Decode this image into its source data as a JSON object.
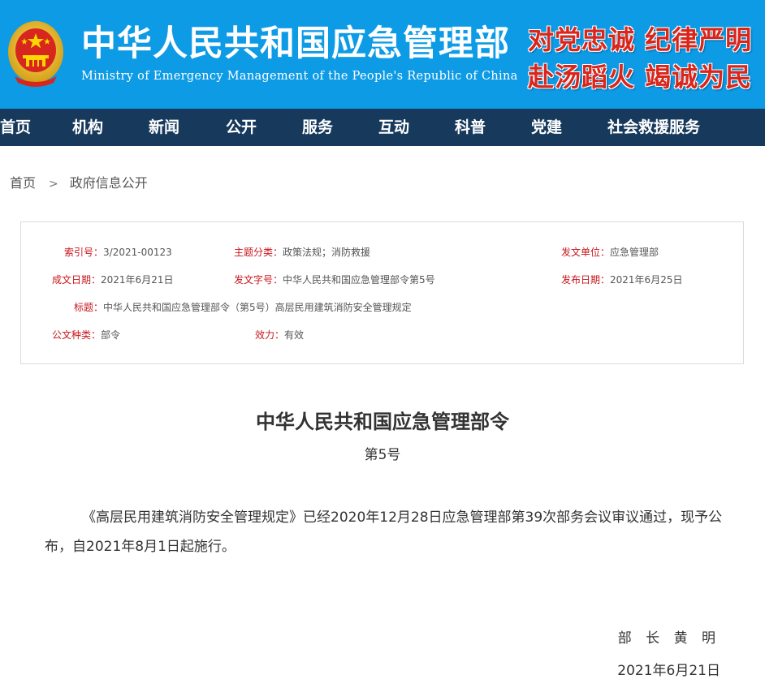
{
  "header": {
    "ministry_cn": "中华人民共和国应急管理部",
    "ministry_en": "Ministry of Emergency Management of the People's Republic of China",
    "slogan_line1": "对党忠诚 纪律严明",
    "slogan_line2": "赴汤蹈火 竭诚为民",
    "emblem_icon": "national-emblem-icon",
    "bg_color": "#0e9be6",
    "slogan_color": "#d9261c"
  },
  "nav": {
    "bg_color": "#16395c",
    "items": [
      "首页",
      "机构",
      "新闻",
      "公开",
      "服务",
      "互动",
      "科普",
      "党建",
      "社会救援服务"
    ]
  },
  "breadcrumb": {
    "home": "首页",
    "separator": ">",
    "current": "政府信息公开"
  },
  "info": {
    "index_label": "索引号：",
    "index_value": "3/2021-00123",
    "topic_label": "主题分类：",
    "topic_value": "政策法规；消防救援",
    "issuer_label": "发文单位：",
    "issuer_value": "应急管理部",
    "created_label": "成文日期：",
    "created_value": "2021年6月21日",
    "docno_label": "发文字号：",
    "docno_value": "中华人民共和国应急管理部令第5号",
    "published_label": "发布日期：",
    "published_value": "2021年6月25日",
    "title_label": "标题：",
    "title_value": "中华人民共和国应急管理部令（第5号）高层民用建筑消防安全管理规定",
    "type_label": "公文种类：",
    "type_value": "部令",
    "validity_label": "效力：",
    "validity_value": "有效",
    "label_color": "#c8161d"
  },
  "document": {
    "title": "中华人民共和国应急管理部令",
    "number": "第5号",
    "body": "《高层民用建筑消防安全管理规定》已经2020年12月28日应急管理部第39次部务会议审议通过，现予公布，自2021年8月1日起施行。",
    "signer": "部 长  黄 明",
    "date": "2021年6月21日"
  }
}
